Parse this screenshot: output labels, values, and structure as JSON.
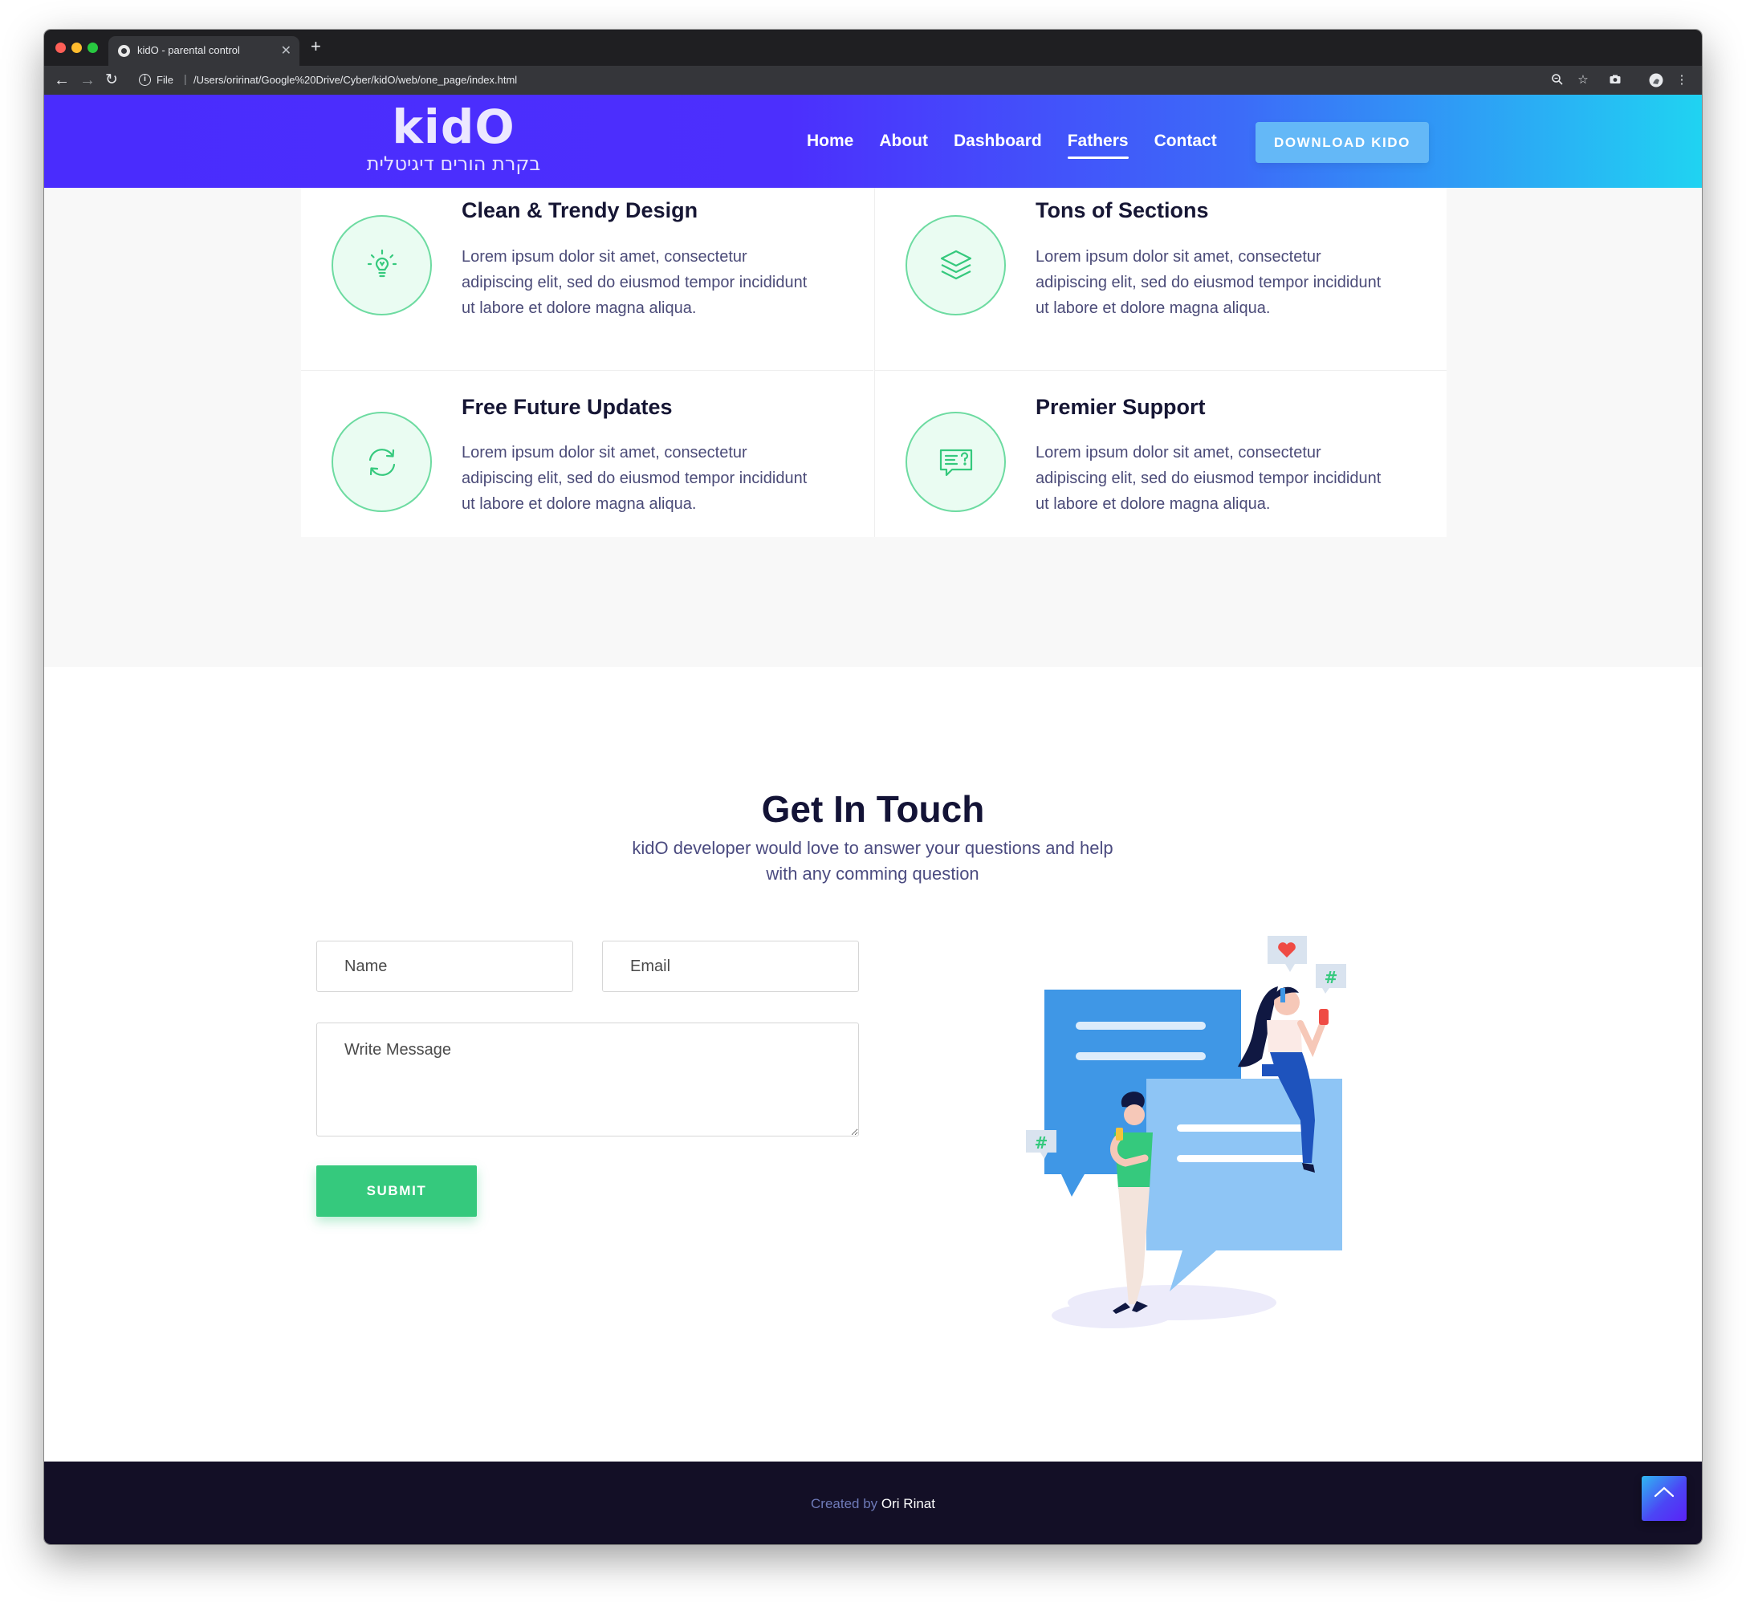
{
  "browser": {
    "tab_title": "kidO - parental control",
    "url_scheme": "File",
    "url": "/Users/oririnat/Google%20Drive/Cyber/kidO/web/one_page/index.html"
  },
  "header": {
    "logo": "kidO",
    "tagline": "בקרת הורים דיגיטלית",
    "menu": [
      {
        "label": "Home",
        "active": false
      },
      {
        "label": "About",
        "active": false
      },
      {
        "label": "Dashboard",
        "active": false
      },
      {
        "label": "Fathers",
        "active": true
      },
      {
        "label": "Contact",
        "active": false
      }
    ],
    "download_label": "DOWNLOAD KIDO"
  },
  "features": [
    {
      "icon": "lightbulb-icon",
      "title": "Clean & Trendy Design",
      "text": "Lorem ipsum dolor sit amet, consectetur adipiscing elit, sed do eiusmod tempor incididunt ut labore et dolore magna aliqua."
    },
    {
      "icon": "layers-icon",
      "title": "Tons of Sections",
      "text": "Lorem ipsum dolor sit amet, consectetur adipiscing elit, sed do eiusmod tempor incididunt ut labore et dolore magna aliqua."
    },
    {
      "icon": "refresh-icon",
      "title": "Free Future Updates",
      "text": "Lorem ipsum dolor sit amet, consectetur adipiscing elit, sed do eiusmod tempor incididunt ut labore et dolore magna aliqua."
    },
    {
      "icon": "support-chat-icon",
      "title": "Premier Support",
      "text": "Lorem ipsum dolor sit amet, consectetur adipiscing elit, sed do eiusmod tempor incididunt ut labore et dolore magna aliqua."
    }
  ],
  "contact": {
    "title": "Get In Touch",
    "subtitle": "kidO developer would love to answer your questions and help with any comming question",
    "name_placeholder": "Name",
    "email_placeholder": "Email",
    "message_placeholder": "Write Message",
    "submit_label": "SUBMIT"
  },
  "footer": {
    "created_by": "Created by",
    "author": "Ori Rinat"
  },
  "colors": {
    "header_gradient_start": "#4a2cfd",
    "header_gradient_end": "#20d3f2",
    "accent_green": "#35c97d",
    "download_button": "#64b8f7",
    "footer_bg": "#130f26"
  }
}
